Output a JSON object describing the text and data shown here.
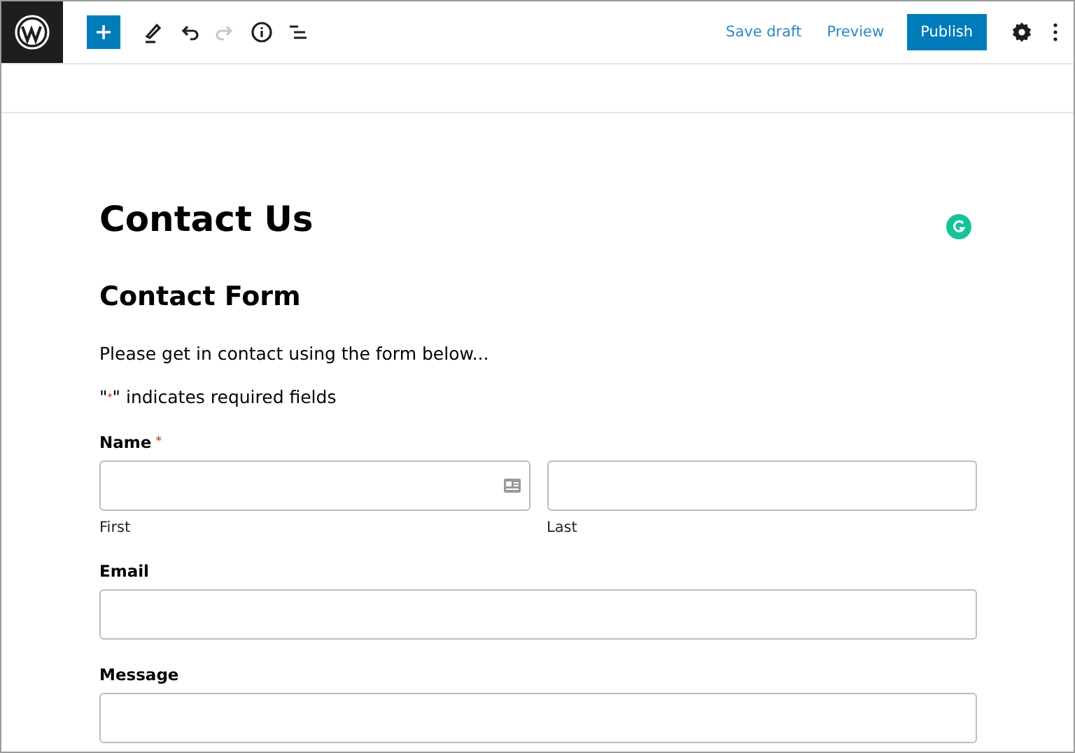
{
  "toolbar": {
    "tools": [
      {
        "kind": "add",
        "disabled": false
      },
      {
        "kind": "pen",
        "disabled": false
      },
      {
        "kind": "undo",
        "disabled": false
      },
      {
        "kind": "redo",
        "disabled": true
      },
      {
        "kind": "info",
        "disabled": false
      },
      {
        "kind": "list",
        "disabled": false
      }
    ],
    "save_draft": "Save draft",
    "preview": "Preview",
    "publish": "Publish"
  },
  "page": {
    "title": "Contact Us",
    "form_title": "Contact Form",
    "intro": "Please get in contact using the form below...",
    "required_note": {
      "before": "\"",
      "mark": "*",
      "after": "\" indicates required fields"
    },
    "fields": [
      {
        "kind": "name",
        "label": "Name",
        "required": true,
        "sublabels": [
          "First",
          "Last"
        ]
      },
      {
        "kind": "single",
        "label": "Email",
        "required": false
      },
      {
        "kind": "single",
        "label": "Message",
        "required": false
      }
    ]
  }
}
